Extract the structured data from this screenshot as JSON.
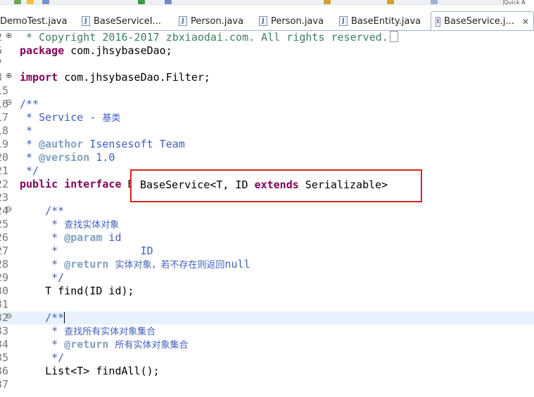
{
  "tabs": [
    {
      "label": "DemoTest.java",
      "icon": "java-file-icon"
    },
    {
      "label": "BaseServiceI...",
      "icon": "java-file-icon"
    },
    {
      "label": "Person.java",
      "icon": "java-file-icon"
    },
    {
      "label": "Person.java",
      "icon": "java-file-icon"
    },
    {
      "label": "BaseEntity.java",
      "icon": "java-file-icon"
    },
    {
      "label": "BaseService.j...",
      "icon": "java-interface-icon",
      "active": true
    }
  ],
  "active_tab_close": "✕",
  "search_text": "Quick A",
  "lines": [
    {
      "num": "2",
      "fold": "⊕",
      "parts": [
        {
          "c": "cm",
          "t": " * Copyright 2016-2017 zbxiaodai.com. All rights reserved."
        }
      ]
    },
    {
      "num": "6",
      "parts": [
        {
          "c": "kw",
          "t": "package"
        },
        {
          "c": "",
          "t": " com.jhsybaseDao;"
        }
      ]
    },
    {
      "num": "7",
      "parts": []
    },
    {
      "num": "8",
      "fold": "⊕",
      "parts": [
        {
          "c": "kw",
          "t": "import"
        },
        {
          "c": "",
          "t": " com.jhsybaseDao.Filter;"
        }
      ]
    },
    {
      "num": "15",
      "parts": []
    },
    {
      "num": "16",
      "fold": "⊖",
      "parts": [
        {
          "c": "jd",
          "t": "/**"
        }
      ]
    },
    {
      "num": "17",
      "parts": [
        {
          "c": "jd",
          "t": " * Service - "
        },
        {
          "c": "jd cn",
          "t": "基类"
        }
      ]
    },
    {
      "num": "18",
      "parts": [
        {
          "c": "jd",
          "t": " *"
        }
      ]
    },
    {
      "num": "19",
      "parts": [
        {
          "c": "jd",
          "t": " * "
        },
        {
          "c": "tag",
          "t": "@author"
        },
        {
          "c": "jd",
          "t": " Isensesoft Team"
        }
      ]
    },
    {
      "num": "20",
      "parts": [
        {
          "c": "jd",
          "t": " * "
        },
        {
          "c": "tag",
          "t": "@version"
        },
        {
          "c": "jd",
          "t": " 1.0"
        }
      ]
    },
    {
      "num": "21",
      "parts": [
        {
          "c": "jd",
          "t": " */"
        }
      ]
    },
    {
      "num": "22",
      "parts": [
        {
          "c": "kw",
          "t": "public"
        },
        {
          "c": "",
          "t": " "
        },
        {
          "c": "kw",
          "t": "interface"
        },
        {
          "c": "",
          "t": " BaseService<T, ID "
        },
        {
          "c": "kw",
          "t": "extends"
        },
        {
          "c": "",
          "t": " Serializable> {"
        }
      ]
    },
    {
      "num": "23",
      "parts": []
    },
    {
      "num": "24",
      "fold": "⊖",
      "parts": [
        {
          "c": "jd",
          "t": "    /**"
        }
      ]
    },
    {
      "num": "25",
      "parts": [
        {
          "c": "jd",
          "t": "     * "
        },
        {
          "c": "jd cn",
          "t": "查找实体对象"
        }
      ]
    },
    {
      "num": "26",
      "parts": [
        {
          "c": "jd",
          "t": "     * "
        },
        {
          "c": "tag",
          "t": "@param"
        },
        {
          "c": "jd",
          "t": " id"
        }
      ]
    },
    {
      "num": "27",
      "parts": [
        {
          "c": "jd",
          "t": "     *             ID"
        }
      ]
    },
    {
      "num": "28",
      "parts": [
        {
          "c": "jd",
          "t": "     * "
        },
        {
          "c": "tag",
          "t": "@return"
        },
        {
          "c": "jd",
          "t": " "
        },
        {
          "c": "jd cn",
          "t": "实体对象，若不存在则返回"
        },
        {
          "c": "jd",
          "t": "null"
        }
      ]
    },
    {
      "num": "29",
      "parts": [
        {
          "c": "jd",
          "t": "     */"
        }
      ]
    },
    {
      "num": "30",
      "parts": [
        {
          "c": "",
          "t": "    T find(ID id);"
        }
      ]
    },
    {
      "num": "31",
      "parts": []
    },
    {
      "num": "32",
      "fold": "⊖",
      "current": true,
      "parts": [
        {
          "c": "jd",
          "t": "    /**"
        }
      ]
    },
    {
      "num": "33",
      "parts": [
        {
          "c": "jd",
          "t": "     * "
        },
        {
          "c": "jd cn",
          "t": "查找所有实体对象集合"
        }
      ]
    },
    {
      "num": "34",
      "parts": [
        {
          "c": "jd",
          "t": "     * "
        },
        {
          "c": "tag",
          "t": "@return"
        },
        {
          "c": "jd",
          "t": " "
        },
        {
          "c": "jd cn",
          "t": "所有实体对象集合"
        }
      ]
    },
    {
      "num": "35",
      "parts": [
        {
          "c": "jd",
          "t": "     */"
        }
      ]
    },
    {
      "num": "36",
      "parts": [
        {
          "c": "",
          "t": "    List<T> findAll();"
        }
      ]
    },
    {
      "num": "37",
      "parts": []
    },
    {
      "num": "",
      "parts": []
    }
  ],
  "highlight": {
    "parts": [
      {
        "c": "",
        "t": "BaseService<T, ID "
      },
      {
        "c": "kw",
        "t": "extends"
      },
      {
        "c": "",
        "t": " Serializable>"
      }
    ]
  },
  "colors": {
    "highlight_border": "#e0201e",
    "keyword": "#7f0055",
    "javadoc": "#3f5fbf",
    "comment": "#3f7f5f",
    "current_line": "#e8f2fe"
  }
}
